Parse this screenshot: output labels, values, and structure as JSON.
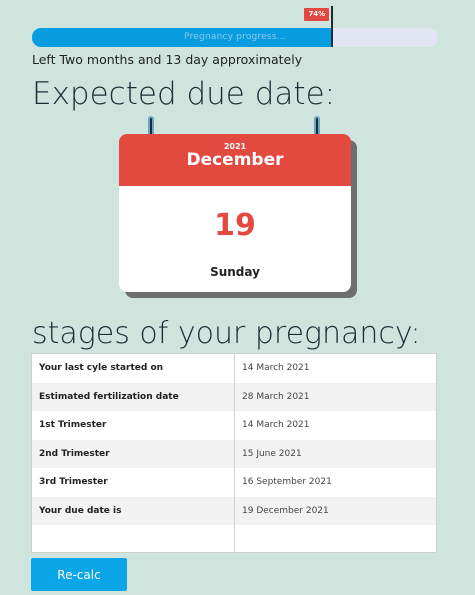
{
  "progress": {
    "label": "Pregnancy progress...",
    "percent": 74,
    "badge": "74%"
  },
  "remaining_text": "Left Two months and 13 day approximately",
  "due_heading": "Expected due date:",
  "calendar": {
    "year": "2021",
    "month": "December",
    "day": "19",
    "weekday": "Sunday"
  },
  "stages_heading": "stages of your pregnancy:",
  "stages": [
    {
      "label": "Your last cyle started on",
      "value": "14 March 2021"
    },
    {
      "label": "Estimated fertilization date",
      "value": "28 March 2021"
    },
    {
      "label": "1st Trimester",
      "value": "14 March 2021"
    },
    {
      "label": "2nd Trimester",
      "value": "15 June 2021"
    },
    {
      "label": "3rd Trimester",
      "value": "16 September 2021"
    },
    {
      "label": "Your due date is",
      "value": "19 December 2021"
    }
  ],
  "recalc_label": "Re-calc",
  "colors": {
    "accent": "#089de0",
    "calendar_red": "#e24a3f",
    "background": "#d0e4de"
  }
}
